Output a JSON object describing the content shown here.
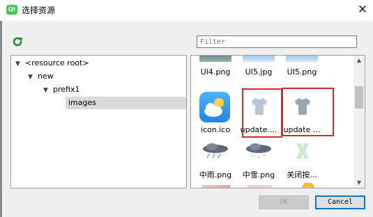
{
  "window": {
    "title": "选择资源",
    "logo_text": "Qt"
  },
  "toolbar": {
    "reload_icon": "reload-icon",
    "filter_placeholder": "Filter"
  },
  "tree": {
    "nodes": [
      {
        "label": "<resource root>",
        "level": 0,
        "expanded": true
      },
      {
        "label": "new",
        "level": 1,
        "expanded": true
      },
      {
        "label": "prefix1",
        "level": 2,
        "expanded": true
      },
      {
        "label": "images",
        "level": 3,
        "selected": true
      }
    ]
  },
  "files": {
    "row1": [
      "UI4.png",
      "UI5.jpg",
      "UI5.png"
    ],
    "row2": [
      "icon.ico",
      "update....",
      "update ..."
    ],
    "row3": [
      "中雨.png",
      "中雪.png",
      "关闭按..."
    ]
  },
  "buttons": {
    "ok": "OK",
    "cancel": "Cancel"
  },
  "colors": {
    "highlight": "#d42b2b",
    "selection": "#d9d9d9",
    "weather_icon_bg": "#3aa0f0"
  }
}
